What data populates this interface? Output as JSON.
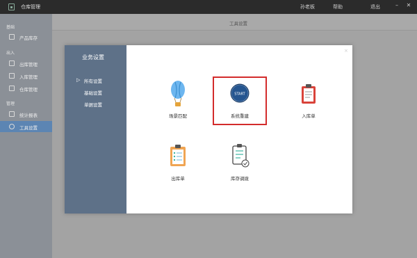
{
  "titlebar": {
    "app_title": "仓库管理",
    "menus": [
      "孙老板",
      "帮助",
      "退出"
    ],
    "minimize": "–",
    "close": "✕"
  },
  "sidebar": {
    "groups": [
      "基础",
      "出入",
      "管理"
    ],
    "items": [
      {
        "label": "产品库存",
        "icon": "box-icon"
      },
      {
        "label": "出库管理",
        "icon": "export-icon"
      },
      {
        "label": "入库管理",
        "icon": "import-icon"
      },
      {
        "label": "仓库管理",
        "icon": "warehouse-icon"
      },
      {
        "label": "统计报表",
        "icon": "chart-icon"
      },
      {
        "label": "工具设置",
        "icon": "gear-icon"
      }
    ],
    "active_index": 5
  },
  "content": {
    "header_title": "工具设置"
  },
  "modal": {
    "title": "业务设置",
    "close": "×",
    "nav": [
      {
        "label": "所有设置",
        "selected": true
      },
      {
        "label": "基础设置",
        "selected": false
      },
      {
        "label": "单据设置",
        "selected": false
      }
    ],
    "tiles": [
      {
        "label": "场景匹配",
        "icon": "balloon-icon",
        "selected": false
      },
      {
        "label": "系统重建",
        "icon": "start-icon",
        "icon_text": "START",
        "selected": true
      },
      {
        "label": "入库单",
        "icon": "clipboard-icon",
        "selected": false
      },
      {
        "label": "出库单",
        "icon": "checklist-clipboard-icon",
        "selected": false
      },
      {
        "label": "库存调拨",
        "icon": "clipboard-check-icon",
        "selected": false
      }
    ]
  },
  "colors": {
    "titlebar": "#2b2b2b",
    "sidebar": "#8b9097",
    "sidebar_active": "#5c85b3",
    "modal_nav": "#5e7188",
    "selection_outline": "#d32b2b",
    "start_blue": "#1f4f8b"
  }
}
